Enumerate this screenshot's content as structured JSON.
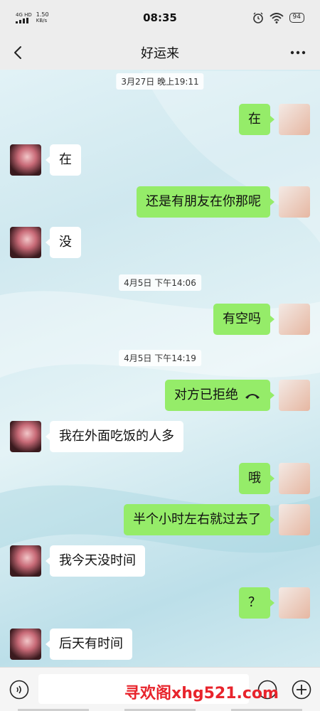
{
  "status_bar": {
    "network": "4G HD",
    "speed_value": "1.50",
    "speed_unit": "KB/s",
    "time": "08:35",
    "battery": "94",
    "icons": [
      "alarm-icon",
      "wifi-icon",
      "battery-icon"
    ]
  },
  "header": {
    "title": "好运来",
    "back_icon": "chevron-left-icon",
    "more_icon": "more-dots-icon"
  },
  "messages": [
    {
      "type": "timestamp",
      "text": "3月27日 晚上19:11"
    },
    {
      "type": "msg",
      "from": "me",
      "text": "在"
    },
    {
      "type": "msg",
      "from": "them",
      "text": "在"
    },
    {
      "type": "msg",
      "from": "me",
      "text": "还是有朋友在你那呢"
    },
    {
      "type": "msg",
      "from": "them",
      "text": "没"
    },
    {
      "type": "timestamp",
      "text": "4月5日 下午14:06"
    },
    {
      "type": "msg",
      "from": "me",
      "text": "有空吗"
    },
    {
      "type": "timestamp",
      "text": "4月5日 下午14:19"
    },
    {
      "type": "msg",
      "from": "me",
      "text": "对方已拒绝",
      "icon": "call-declined-icon"
    },
    {
      "type": "msg",
      "from": "them",
      "text": "我在外面吃饭的人多"
    },
    {
      "type": "msg",
      "from": "me",
      "text": "哦"
    },
    {
      "type": "msg",
      "from": "me",
      "text": "半个小时左右就过去了"
    },
    {
      "type": "msg",
      "from": "them",
      "text": "我今天没时间"
    },
    {
      "type": "msg",
      "from": "me",
      "text": "？"
    },
    {
      "type": "msg",
      "from": "them",
      "text": "后天有时间"
    }
  ],
  "input_bar": {
    "voice_icon": "voice-icon",
    "emoji_icon": "emoji-icon",
    "plus_icon": "plus-icon",
    "watermark": "寻欢阁xhg521.com"
  },
  "colors": {
    "my_bubble": "#95ec69",
    "their_bubble": "#ffffff",
    "bar_bg": "#ededed",
    "watermark": "#e8242c"
  }
}
